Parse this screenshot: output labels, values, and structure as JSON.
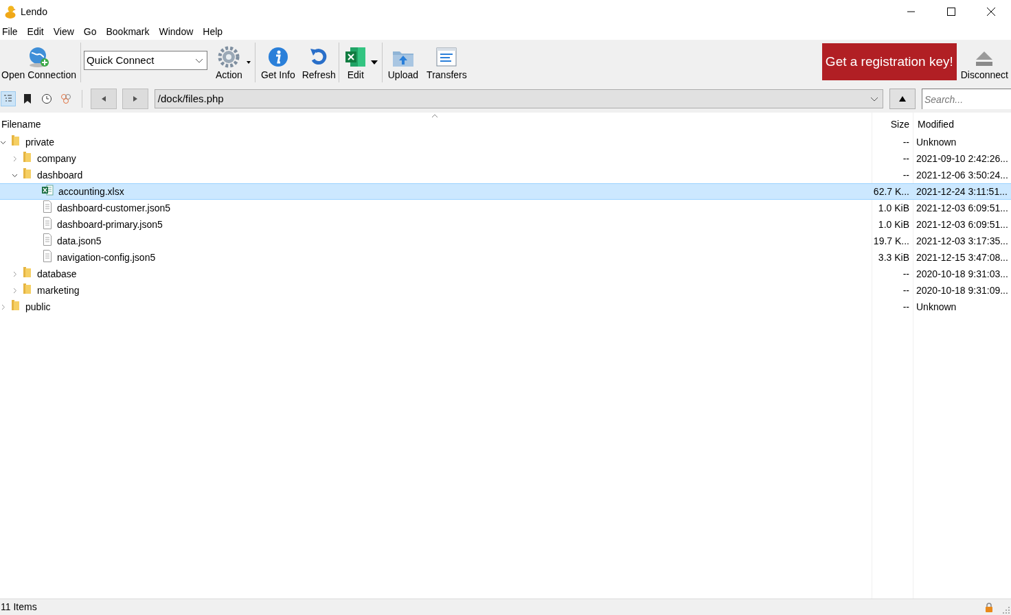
{
  "window": {
    "title": "Lendo"
  },
  "menu": [
    "File",
    "Edit",
    "View",
    "Go",
    "Bookmark",
    "Window",
    "Help"
  ],
  "toolbar": {
    "open_connection": "Open Connection",
    "quick_connect": "Quick Connect",
    "action": "Action",
    "get_info": "Get Info",
    "refresh": "Refresh",
    "edit": "Edit",
    "upload": "Upload",
    "transfers": "Transfers",
    "registration": "Get a registration key!",
    "disconnect": "Disconnect"
  },
  "view_buttons": [
    {
      "kind": "browser",
      "selected": true
    },
    {
      "kind": "bookmarks",
      "selected": false
    },
    {
      "kind": "history",
      "selected": false
    },
    {
      "kind": "bonjour",
      "selected": false
    }
  ],
  "path": "/dock/files.php",
  "search": {
    "placeholder": "Search..."
  },
  "table": {
    "columns": [
      "Filename",
      "Size",
      "Modified"
    ],
    "rows": [
      {
        "kind": "folder",
        "name": "private",
        "size": "--",
        "modified": "Unknown",
        "expanded": true,
        "selected": false,
        "children": [
          {
            "kind": "folder",
            "name": "company",
            "size": "--",
            "modified": "2021-09-10 2:42:26...",
            "expanded": false,
            "selected": false
          },
          {
            "kind": "folder",
            "name": "dashboard",
            "size": "--",
            "modified": "2021-12-06 3:50:24...",
            "expanded": true,
            "selected": false,
            "children": [
              {
                "kind": "xlsx",
                "name": "accounting.xlsx",
                "size": "62.7 K...",
                "modified": "2021-12-24 3:11:51...",
                "selected": true
              },
              {
                "kind": "file",
                "name": "dashboard-customer.json5",
                "size": "1.0 KiB",
                "modified": "2021-12-03 6:09:51...",
                "selected": false
              },
              {
                "kind": "file",
                "name": "dashboard-primary.json5",
                "size": "1.0 KiB",
                "modified": "2021-12-03 6:09:51...",
                "selected": false
              },
              {
                "kind": "file",
                "name": "data.json5",
                "size": "19.7 K...",
                "modified": "2021-12-03 3:17:35...",
                "selected": false
              },
              {
                "kind": "file",
                "name": "navigation-config.json5",
                "size": "3.3 KiB",
                "modified": "2021-12-15 3:47:08...",
                "selected": false
              }
            ]
          },
          {
            "kind": "folder",
            "name": "database",
            "size": "--",
            "modified": "2020-10-18 9:31:03...",
            "expanded": false,
            "selected": false
          },
          {
            "kind": "folder",
            "name": "marketing",
            "size": "--",
            "modified": "2020-10-18 9:31:09...",
            "expanded": false,
            "selected": false
          }
        ]
      },
      {
        "kind": "folder",
        "name": "public",
        "size": "--",
        "modified": "Unknown",
        "expanded": false,
        "selected": false
      }
    ]
  },
  "status_bar": "11 Items"
}
